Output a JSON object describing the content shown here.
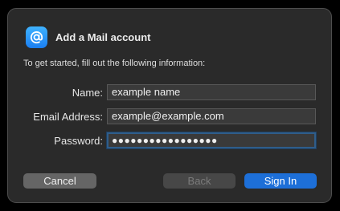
{
  "dialog": {
    "title": "Add a Mail account",
    "instructions": "To get started, fill out the following information:",
    "app_icon": "at-sign-icon",
    "accent_color": "#1d6fd8"
  },
  "form": {
    "name": {
      "label": "Name:",
      "value": "example name"
    },
    "email": {
      "label": "Email Address:",
      "value": "example@example.com"
    },
    "password": {
      "label": "Password:",
      "value": "●●●●●●●●●●●●●●●●●"
    }
  },
  "buttons": {
    "cancel": "Cancel",
    "back": "Back",
    "sign_in": "Sign In"
  }
}
